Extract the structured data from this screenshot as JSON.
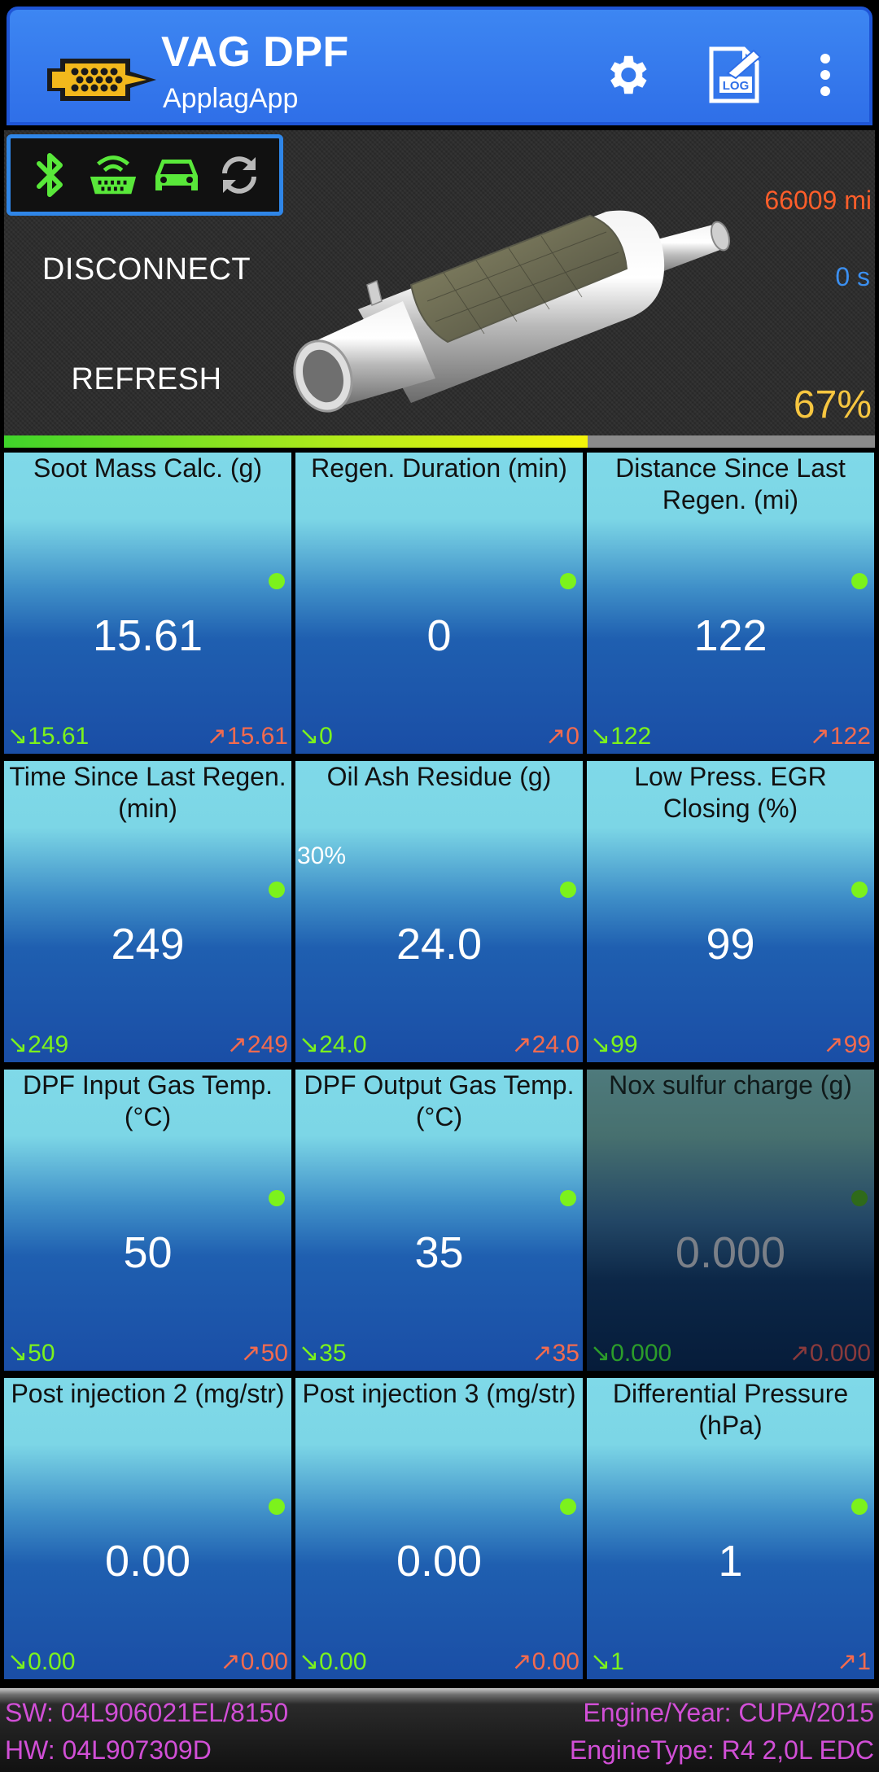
{
  "app": {
    "title": "VAG DPF",
    "subtitle": "ApplagApp",
    "accent": "#3d86f2",
    "actions": [
      "gear-icon",
      "log-icon",
      "more-vert-icon"
    ]
  },
  "status_icons": [
    "bluetooth-icon",
    "obd-adapter-icon",
    "car-icon",
    "sync-icon"
  ],
  "controls": {
    "disconnect": "DISCONNECT",
    "refresh": "REFRESH"
  },
  "readouts": {
    "odometer": "66009 mi",
    "timer": "0 s",
    "soot_percent_label": "67%",
    "soot_progress": 0.67
  },
  "tiles": [
    {
      "label": "Soot Mass Calc. (g)",
      "value": "15.61",
      "min": "↘15.61",
      "max": "↗15.61",
      "active": true
    },
    {
      "label": "Regen. Duration (min)",
      "value": "0",
      "min": "↘0",
      "max": "↗0",
      "active": true
    },
    {
      "label": "Distance Since Last Regen. (mi)",
      "value": "122",
      "min": "↘122",
      "max": "↗122",
      "active": true
    },
    {
      "label": "Time Since Last Regen. (min)",
      "value": "249",
      "min": "↘249",
      "max": "↗249",
      "active": true
    },
    {
      "label": "Oil Ash Residue (g)",
      "value": "24.0",
      "min": "↘24.0",
      "max": "↗24.0",
      "extra": "30%",
      "active": true
    },
    {
      "label": "Low Press. EGR Closing (%)",
      "value": "99",
      "min": "↘99",
      "max": "↗99",
      "active": true
    },
    {
      "label": "DPF Input Gas Temp. (°C)",
      "value": "50",
      "min": "↘50",
      "max": "↗50",
      "active": true
    },
    {
      "label": "DPF Output Gas Temp. (°C)",
      "value": "35",
      "min": "↘35",
      "max": "↗35",
      "active": true
    },
    {
      "label": "Nox sulfur charge (g)",
      "value": "0.000",
      "min": "↘0.000",
      "max": "↗0.000",
      "active": false
    },
    {
      "label": "Post injection 2 (mg/str)",
      "value": "0.00",
      "min": "↘0.00",
      "max": "↗0.00",
      "active": true
    },
    {
      "label": "Post injection 3 (mg/str)",
      "value": "0.00",
      "min": "↘0.00",
      "max": "↗0.00",
      "active": true
    },
    {
      "label": "Differential Pressure (hPa)",
      "value": "1",
      "min": "↘1",
      "max": "↗1",
      "active": true
    }
  ],
  "footer": {
    "sw": "SW: 04L906021EL/8150",
    "hw": "HW: 04L907309D",
    "engine_year": "Engine/Year: CUPA/2015",
    "engine_type": "EngineType: R4 2,0L EDC"
  }
}
